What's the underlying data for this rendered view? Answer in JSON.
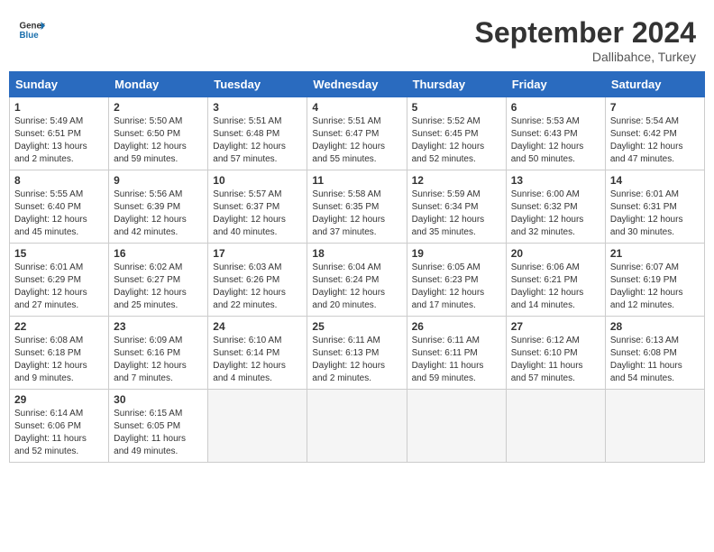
{
  "header": {
    "logo_line1": "General",
    "logo_line2": "Blue",
    "month_title": "September 2024",
    "subtitle": "Dallibahce, Turkey"
  },
  "weekdays": [
    "Sunday",
    "Monday",
    "Tuesday",
    "Wednesday",
    "Thursday",
    "Friday",
    "Saturday"
  ],
  "days": [
    {
      "num": "",
      "info": ""
    },
    {
      "num": "",
      "info": ""
    },
    {
      "num": "",
      "info": ""
    },
    {
      "num": "",
      "info": ""
    },
    {
      "num": "",
      "info": ""
    },
    {
      "num": "",
      "info": ""
    },
    {
      "num": "1",
      "info": "Sunrise: 5:49 AM\nSunset: 6:51 PM\nDaylight: 13 hours\nand 2 minutes."
    },
    {
      "num": "2",
      "info": "Sunrise: 5:50 AM\nSunset: 6:50 PM\nDaylight: 12 hours\nand 59 minutes."
    },
    {
      "num": "3",
      "info": "Sunrise: 5:51 AM\nSunset: 6:48 PM\nDaylight: 12 hours\nand 57 minutes."
    },
    {
      "num": "4",
      "info": "Sunrise: 5:51 AM\nSunset: 6:47 PM\nDaylight: 12 hours\nand 55 minutes."
    },
    {
      "num": "5",
      "info": "Sunrise: 5:52 AM\nSunset: 6:45 PM\nDaylight: 12 hours\nand 52 minutes."
    },
    {
      "num": "6",
      "info": "Sunrise: 5:53 AM\nSunset: 6:43 PM\nDaylight: 12 hours\nand 50 minutes."
    },
    {
      "num": "7",
      "info": "Sunrise: 5:54 AM\nSunset: 6:42 PM\nDaylight: 12 hours\nand 47 minutes."
    },
    {
      "num": "8",
      "info": "Sunrise: 5:55 AM\nSunset: 6:40 PM\nDaylight: 12 hours\nand 45 minutes."
    },
    {
      "num": "9",
      "info": "Sunrise: 5:56 AM\nSunset: 6:39 PM\nDaylight: 12 hours\nand 42 minutes."
    },
    {
      "num": "10",
      "info": "Sunrise: 5:57 AM\nSunset: 6:37 PM\nDaylight: 12 hours\nand 40 minutes."
    },
    {
      "num": "11",
      "info": "Sunrise: 5:58 AM\nSunset: 6:35 PM\nDaylight: 12 hours\nand 37 minutes."
    },
    {
      "num": "12",
      "info": "Sunrise: 5:59 AM\nSunset: 6:34 PM\nDaylight: 12 hours\nand 35 minutes."
    },
    {
      "num": "13",
      "info": "Sunrise: 6:00 AM\nSunset: 6:32 PM\nDaylight: 12 hours\nand 32 minutes."
    },
    {
      "num": "14",
      "info": "Sunrise: 6:01 AM\nSunset: 6:31 PM\nDaylight: 12 hours\nand 30 minutes."
    },
    {
      "num": "15",
      "info": "Sunrise: 6:01 AM\nSunset: 6:29 PM\nDaylight: 12 hours\nand 27 minutes."
    },
    {
      "num": "16",
      "info": "Sunrise: 6:02 AM\nSunset: 6:27 PM\nDaylight: 12 hours\nand 25 minutes."
    },
    {
      "num": "17",
      "info": "Sunrise: 6:03 AM\nSunset: 6:26 PM\nDaylight: 12 hours\nand 22 minutes."
    },
    {
      "num": "18",
      "info": "Sunrise: 6:04 AM\nSunset: 6:24 PM\nDaylight: 12 hours\nand 20 minutes."
    },
    {
      "num": "19",
      "info": "Sunrise: 6:05 AM\nSunset: 6:23 PM\nDaylight: 12 hours\nand 17 minutes."
    },
    {
      "num": "20",
      "info": "Sunrise: 6:06 AM\nSunset: 6:21 PM\nDaylight: 12 hours\nand 14 minutes."
    },
    {
      "num": "21",
      "info": "Sunrise: 6:07 AM\nSunset: 6:19 PM\nDaylight: 12 hours\nand 12 minutes."
    },
    {
      "num": "22",
      "info": "Sunrise: 6:08 AM\nSunset: 6:18 PM\nDaylight: 12 hours\nand 9 minutes."
    },
    {
      "num": "23",
      "info": "Sunrise: 6:09 AM\nSunset: 6:16 PM\nDaylight: 12 hours\nand 7 minutes."
    },
    {
      "num": "24",
      "info": "Sunrise: 6:10 AM\nSunset: 6:14 PM\nDaylight: 12 hours\nand 4 minutes."
    },
    {
      "num": "25",
      "info": "Sunrise: 6:11 AM\nSunset: 6:13 PM\nDaylight: 12 hours\nand 2 minutes."
    },
    {
      "num": "26",
      "info": "Sunrise: 6:11 AM\nSunset: 6:11 PM\nDaylight: 11 hours\nand 59 minutes."
    },
    {
      "num": "27",
      "info": "Sunrise: 6:12 AM\nSunset: 6:10 PM\nDaylight: 11 hours\nand 57 minutes."
    },
    {
      "num": "28",
      "info": "Sunrise: 6:13 AM\nSunset: 6:08 PM\nDaylight: 11 hours\nand 54 minutes."
    },
    {
      "num": "29",
      "info": "Sunrise: 6:14 AM\nSunset: 6:06 PM\nDaylight: 11 hours\nand 52 minutes."
    },
    {
      "num": "30",
      "info": "Sunrise: 6:15 AM\nSunset: 6:05 PM\nDaylight: 11 hours\nand 49 minutes."
    },
    {
      "num": "",
      "info": ""
    },
    {
      "num": "",
      "info": ""
    },
    {
      "num": "",
      "info": ""
    },
    {
      "num": "",
      "info": ""
    },
    {
      "num": "",
      "info": ""
    }
  ]
}
